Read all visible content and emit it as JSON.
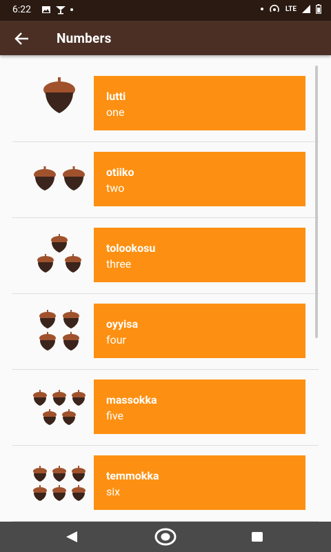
{
  "status": {
    "time": "6:22",
    "network": "LTE"
  },
  "appbar": {
    "title": "Numbers"
  },
  "rows": [
    {
      "miwok": "lutti",
      "english": "one"
    },
    {
      "miwok": "otiiko",
      "english": "two"
    },
    {
      "miwok": "tolookosu",
      "english": "three"
    },
    {
      "miwok": "oyyisa",
      "english": "four"
    },
    {
      "miwok": "massokka",
      "english": "five"
    },
    {
      "miwok": "temmokka",
      "english": "six"
    }
  ],
  "colors": {
    "statusbar": "#2a1a12",
    "appbar": "#4b2f25",
    "card": "#fd9012",
    "acorn_cap": "#a0522d",
    "acorn_body": "#3b241b"
  },
  "icons": {
    "back": "arrow-back-icon",
    "nav_back": "triangle-back-icon",
    "nav_home": "circle-home-icon",
    "nav_recents": "square-recents-icon"
  }
}
